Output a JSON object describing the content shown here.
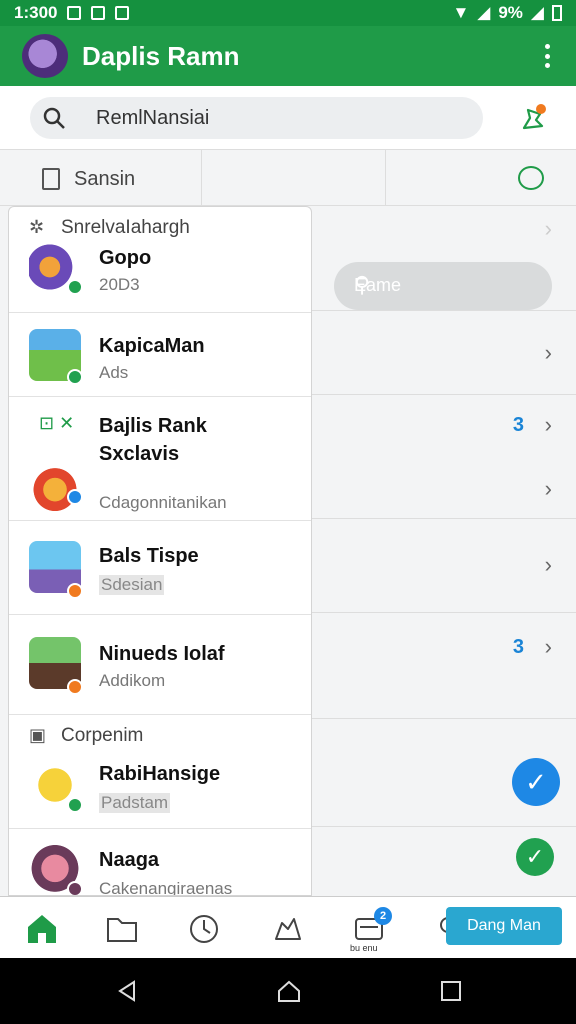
{
  "status_bar": {
    "time": "1:300",
    "battery": "9%"
  },
  "app_bar": {
    "title": "Daplis Ramn",
    "more_icon": "more-vertical-icon"
  },
  "search": {
    "value": "RemlNansiai",
    "icon": "search-icon"
  },
  "tabs": {
    "label": "Sansin"
  },
  "right_search": {
    "placeholder": "Eame"
  },
  "sections": [
    {
      "label": "SnrelvaIahargh"
    },
    {
      "label": "Corpenim"
    }
  ],
  "list": [
    {
      "name": "Gopo",
      "sub": "20D3"
    },
    {
      "name": "KapicaMan",
      "sub": "Ads"
    },
    {
      "name": "Bajlis Rank",
      "name2": "Sxclavis",
      "sub": "Cdagonnitanikan"
    },
    {
      "name": "Bals Tispe",
      "sub": "Sdesian"
    },
    {
      "name": "Ninueds Iolaf",
      "sub": "Addikom"
    },
    {
      "name": "RabiHansige",
      "sub": "Padstam"
    },
    {
      "name": "Naaga",
      "sub": "Cakenangiraenas"
    }
  ],
  "right_rows": {
    "count_a": "3",
    "count_b": "3"
  },
  "bottom_nav": {
    "action_label": "Dang Man",
    "caption": "bu enu",
    "badge_a": "2"
  },
  "colors": {
    "brand_green": "#1f9b48",
    "status_green": "#15913f",
    "accent_blue": "#1a84d6",
    "fab_blue": "#1e88e5",
    "fab_green": "#21a150"
  }
}
